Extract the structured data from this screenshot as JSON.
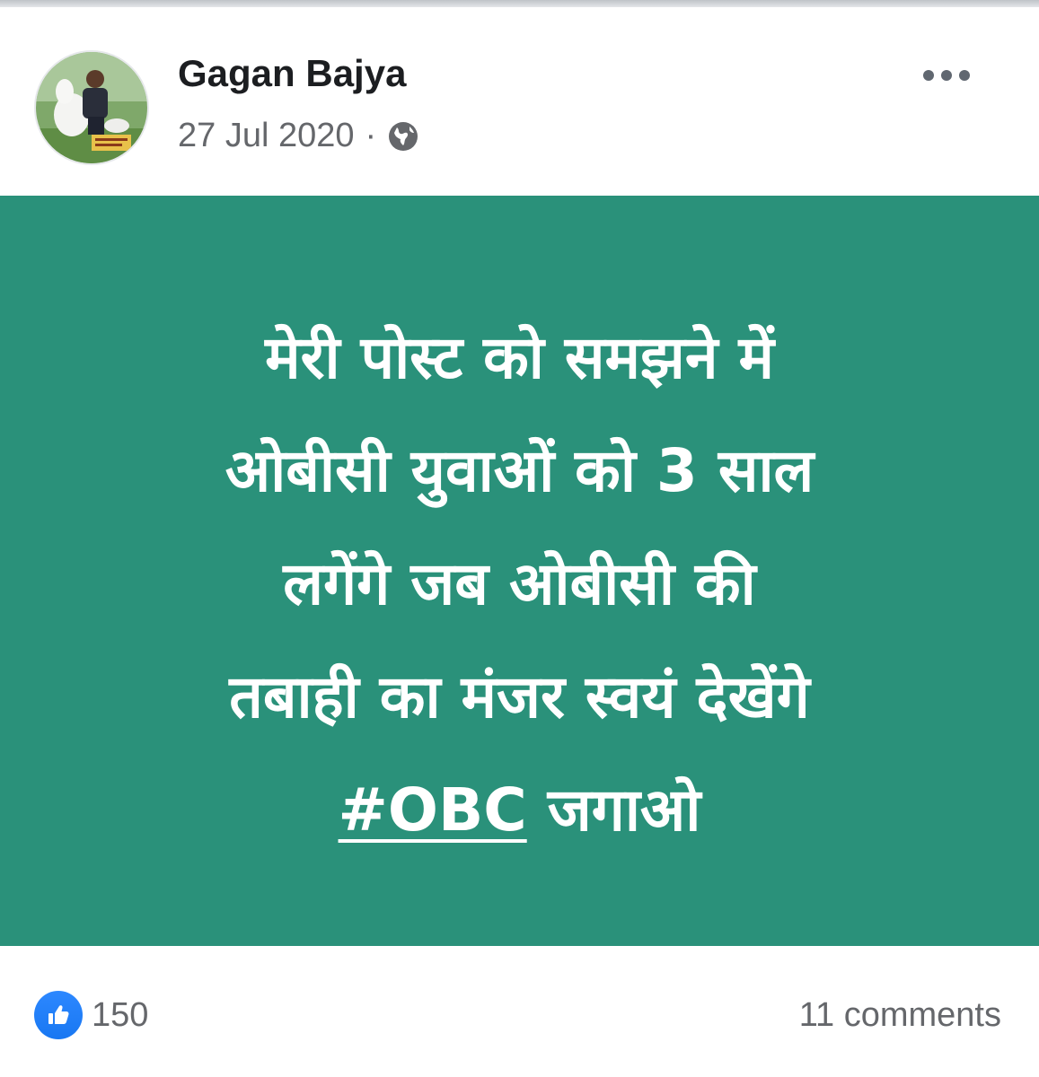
{
  "post": {
    "author_name": "Gagan Bajya",
    "date": "27 Jul 2020",
    "separator": "·",
    "privacy_icon": "globe-icon",
    "more_icon": "more-options-icon",
    "background_color": "#2a917a",
    "text_lines": [
      "मेरी पोस्ट को समझने में",
      "ओबीसी युवाओं को 3 साल",
      "लगेंगे जब ओबीसी  की",
      "तबाही का मंजर स्वयं देखेंगे"
    ],
    "hashtag": "#OBC",
    "hashtag_suffix": "जगाओ"
  },
  "footer": {
    "like_icon": "thumbs-up-icon",
    "like_count": "150",
    "comments_label": "11 comments"
  }
}
